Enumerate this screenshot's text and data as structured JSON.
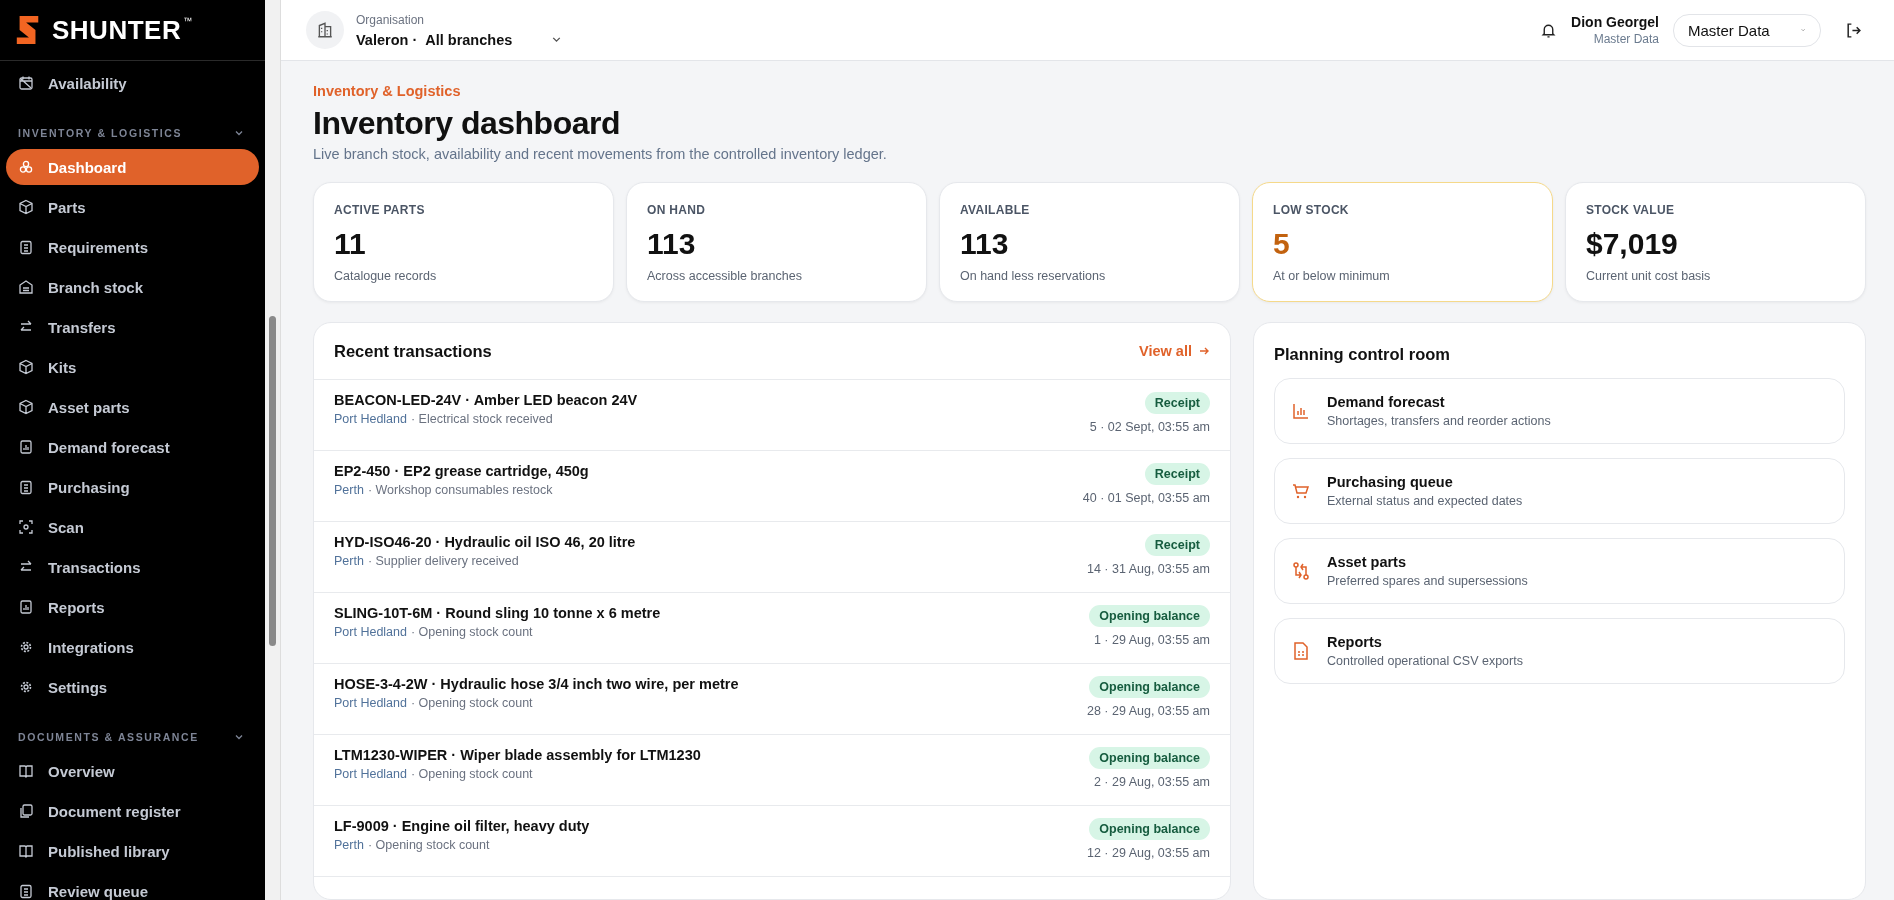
{
  "brand": {
    "name": "SHUNTER",
    "mark": "™"
  },
  "sidebar": {
    "top_items": [
      {
        "label": "Availability",
        "selected": false
      }
    ],
    "sections": [
      {
        "title": "INVENTORY & LOGISTICS",
        "expanded": true,
        "items": [
          {
            "label": "Dashboard",
            "selected": true
          },
          {
            "label": "Parts",
            "selected": false
          },
          {
            "label": "Requirements",
            "selected": false
          },
          {
            "label": "Branch stock",
            "selected": false
          },
          {
            "label": "Transfers",
            "selected": false
          },
          {
            "label": "Kits",
            "selected": false
          },
          {
            "label": "Asset parts",
            "selected": false
          },
          {
            "label": "Demand forecast",
            "selected": false
          },
          {
            "label": "Purchasing",
            "selected": false
          },
          {
            "label": "Scan",
            "selected": false
          },
          {
            "label": "Transactions",
            "selected": false
          },
          {
            "label": "Reports",
            "selected": false
          },
          {
            "label": "Integrations",
            "selected": false
          },
          {
            "label": "Settings",
            "selected": false
          }
        ]
      },
      {
        "title": "DOCUMENTS & ASSURANCE",
        "expanded": true,
        "items": [
          {
            "label": "Overview",
            "selected": false
          },
          {
            "label": "Document register",
            "selected": false
          },
          {
            "label": "Published library",
            "selected": false
          },
          {
            "label": "Review queue",
            "selected": false
          }
        ]
      }
    ]
  },
  "header": {
    "org_label": "Organisation",
    "org_name": "Valeron ·",
    "branch": "All branches",
    "user_name": "Dion Georgel",
    "user_role": "Master Data",
    "workspace": "Master Data"
  },
  "page": {
    "eyebrow": "Inventory & Logistics",
    "title": "Inventory dashboard",
    "subtitle": "Live branch stock, availability and recent movements from the controlled inventory ledger."
  },
  "stats": [
    {
      "label": "ACTIVE PARTS",
      "value": "11",
      "note": "Catalogue records",
      "warning": false
    },
    {
      "label": "ON HAND",
      "value": "113",
      "note": "Across accessible branches",
      "warning": false
    },
    {
      "label": "AVAILABLE",
      "value": "113",
      "note": "On hand less reservations",
      "warning": false
    },
    {
      "label": "LOW STOCK",
      "value": "5",
      "note": "At or below minimum",
      "warning": true
    },
    {
      "label": "STOCK VALUE",
      "value": "$7,019",
      "note": "Current unit cost basis",
      "warning": false
    }
  ],
  "transactions": {
    "title": "Recent transactions",
    "view_all": "View all",
    "rows": [
      {
        "title": "BEACON-LED-24V · Amber LED beacon 24V",
        "branch": "Port Hedland",
        "detail": "· Electrical stock received",
        "type": "Receipt",
        "meta": "5 · 02 Sept, 03:55 am"
      },
      {
        "title": "EP2-450 · EP2 grease cartridge, 450g",
        "branch": "Perth",
        "detail": "· Workshop consumables restock",
        "type": "Receipt",
        "meta": "40 · 01 Sept, 03:55 am"
      },
      {
        "title": "HYD-ISO46-20 · Hydraulic oil ISO 46, 20 litre",
        "branch": "Perth",
        "detail": "· Supplier delivery received",
        "type": "Receipt",
        "meta": "14 · 31 Aug, 03:55 am"
      },
      {
        "title": "SLING-10T-6M · Round sling 10 tonne x 6 metre",
        "branch": "Port Hedland",
        "detail": "· Opening stock count",
        "type": "Opening balance",
        "meta": "1 · 29 Aug, 03:55 am"
      },
      {
        "title": "HOSE-3-4-2W · Hydraulic hose 3/4 inch two wire, per metre",
        "branch": "Port Hedland",
        "detail": "· Opening stock count",
        "type": "Opening balance",
        "meta": "28 · 29 Aug, 03:55 am"
      },
      {
        "title": "LTM1230-WIPER · Wiper blade assembly for LTM1230",
        "branch": "Port Hedland",
        "detail": "· Opening stock count",
        "type": "Opening balance",
        "meta": "2 · 29 Aug, 03:55 am"
      },
      {
        "title": "LF-9009 · Engine oil filter, heavy duty",
        "branch": "Perth",
        "detail": "· Opening stock count",
        "type": "Opening balance",
        "meta": "12 · 29 Aug, 03:55 am"
      }
    ]
  },
  "planning": {
    "title": "Planning control room",
    "items": [
      {
        "title": "Demand forecast",
        "desc": "Shortages, transfers and reorder actions"
      },
      {
        "title": "Purchasing queue",
        "desc": "External status and expected dates"
      },
      {
        "title": "Asset parts",
        "desc": "Preferred spares and supersessions"
      },
      {
        "title": "Reports",
        "desc": "Controlled operational CSV exports"
      }
    ]
  }
}
